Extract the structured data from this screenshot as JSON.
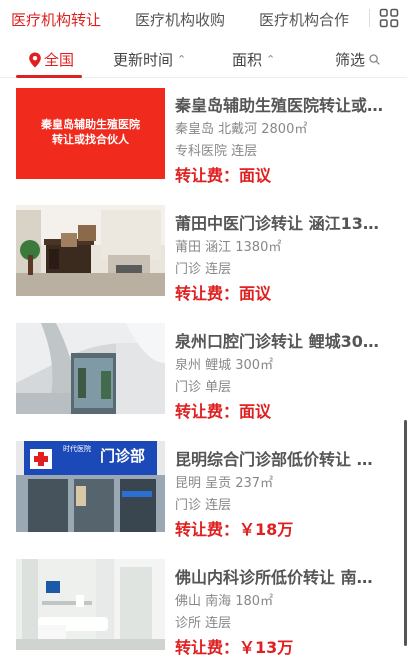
{
  "topnav": {
    "tabs": [
      "医疗机构转让",
      "医疗机构收购",
      "医疗机构合作"
    ],
    "active_index": 0,
    "menu_icon": "grid-apps-icon"
  },
  "filters": {
    "all": "全国",
    "time": "更新时间",
    "area": "面积",
    "screen": "筛选",
    "pin_icon": "location-pin-icon",
    "caret": "⌃⌄",
    "search_icon": "search-icon"
  },
  "colors": {
    "accent": "#e02020"
  },
  "listings": [
    {
      "image_text": [
        "秦皇岛辅助生殖医院",
        "转让或找合伙人"
      ],
      "title": "秦皇岛辅助生殖医院转让或…",
      "location": "秦皇岛 北戴河 2800㎡",
      "category": "专科医院 连层",
      "price": "转让费：面议"
    },
    {
      "title": "莆田中医门诊转让 涵江13…",
      "location": "莆田 涵江 1380㎡",
      "category": "门诊 连层",
      "price": "转让费：面议"
    },
    {
      "title": "泉州口腔门诊转让 鲤城30…",
      "location": "泉州 鲤城 300㎡",
      "category": "门诊 单层",
      "price": "转让费：面议"
    },
    {
      "image_text": [
        "门诊部",
        "时代医院"
      ],
      "title": "昆明综合门诊部低价转让 …",
      "location": "昆明 呈贡 237㎡",
      "category": "门诊 连层",
      "price": "转让费：￥18万"
    },
    {
      "title": "佛山内科诊所低价转让 南…",
      "location": "佛山 南海 180㎡",
      "category": "诊所 连层",
      "price": "转让费：￥13万"
    }
  ]
}
